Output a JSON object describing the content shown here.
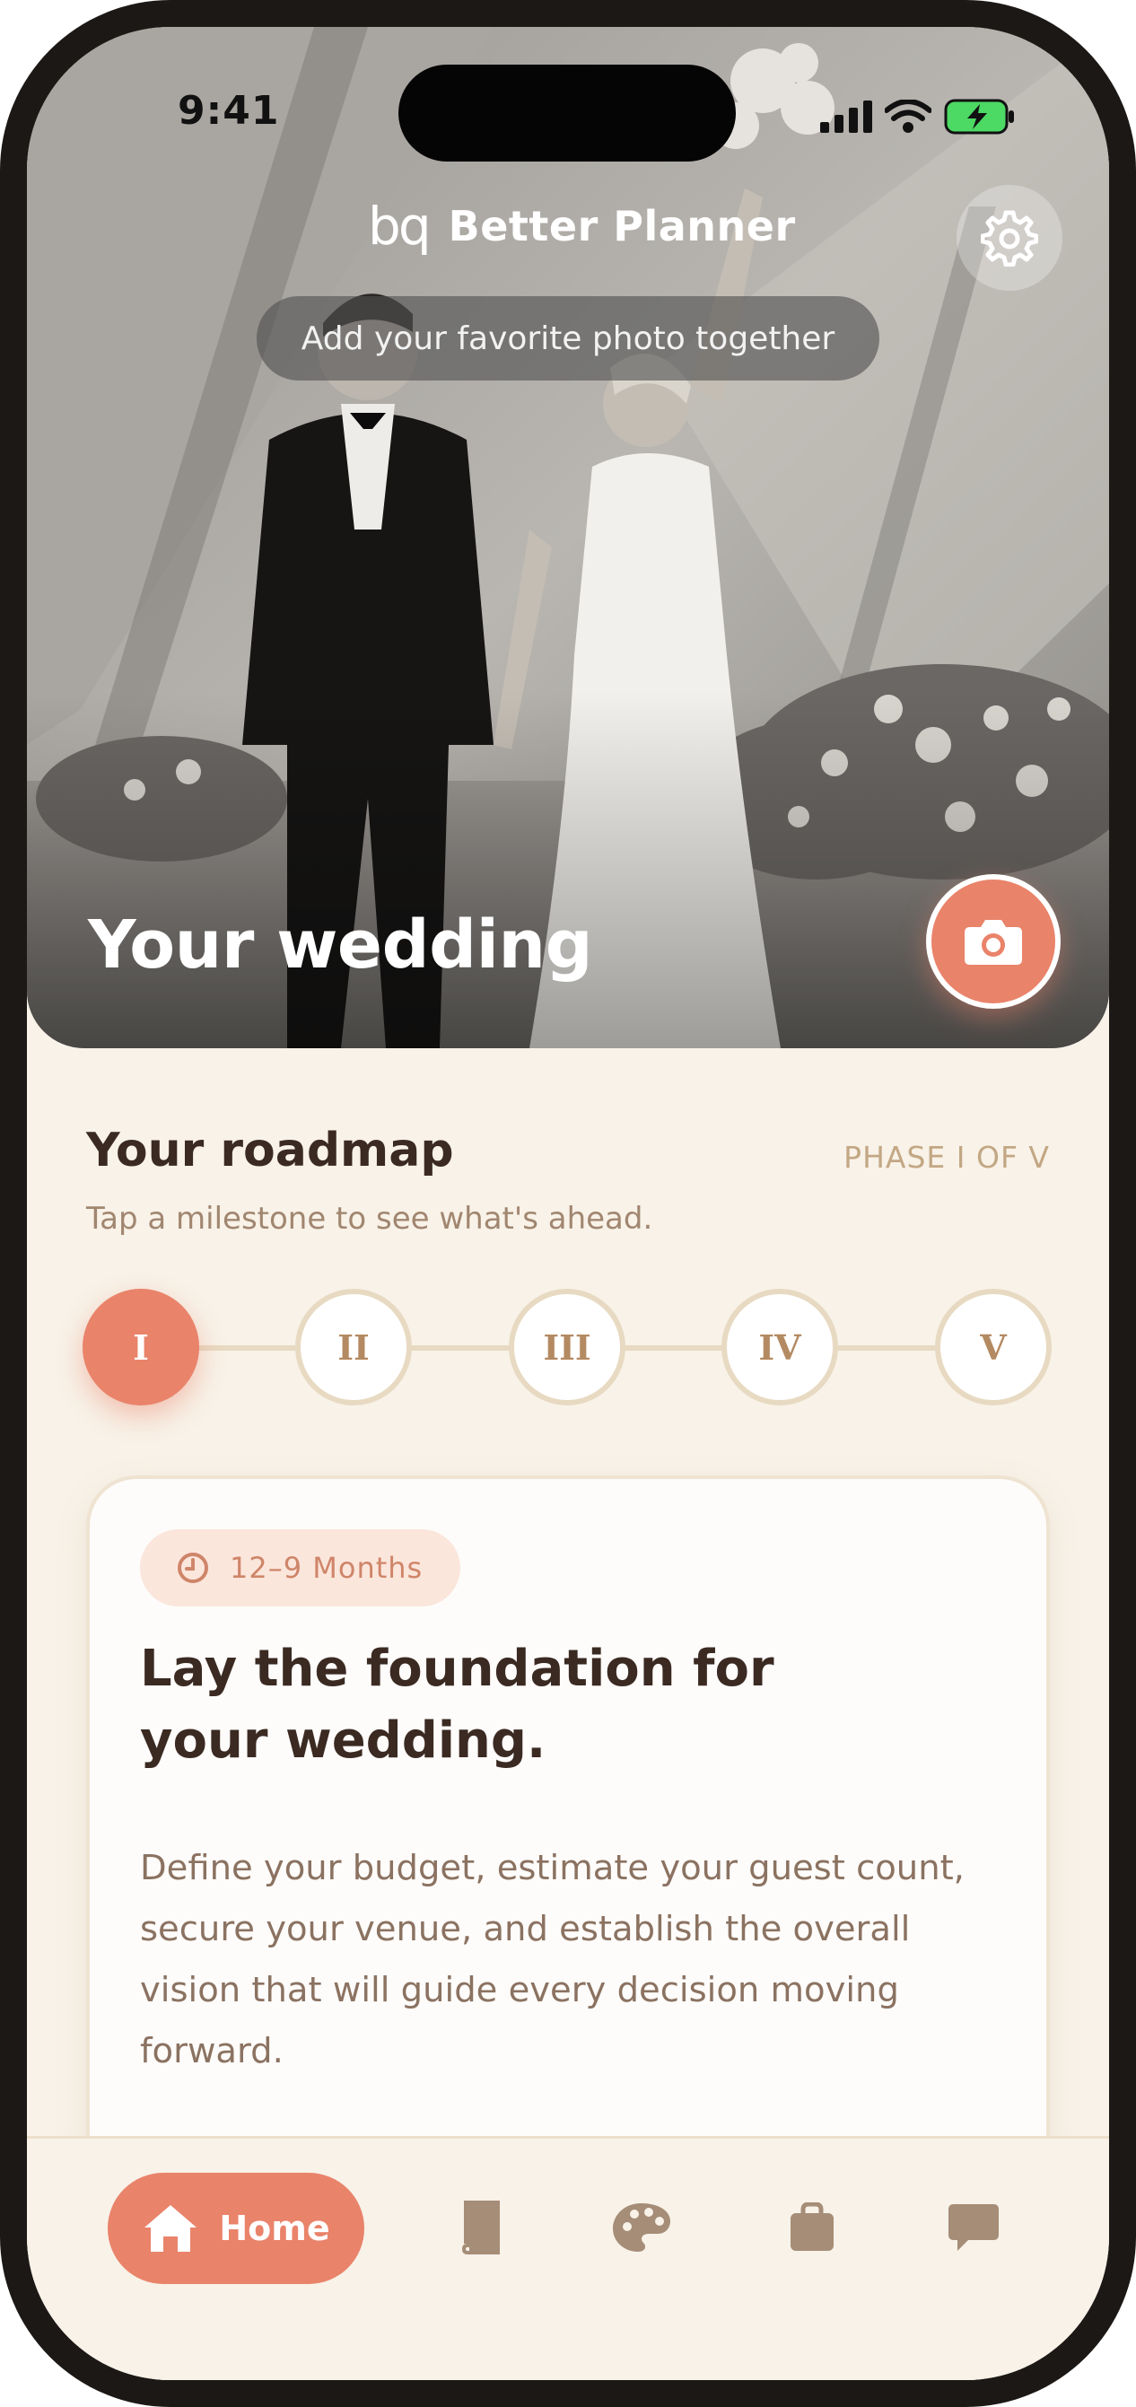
{
  "status_bar": {
    "time": "9:41"
  },
  "header": {
    "brand_logo": "bq",
    "brand_name": "Better Planner"
  },
  "hero": {
    "photo_prompt": "Add your favorite photo together",
    "title": "Your wedding"
  },
  "roadmap": {
    "title": "Your roadmap",
    "phase_label": "PHASE I OF V",
    "subtitle": "Tap a milestone to see what's ahead.",
    "milestones": [
      "I",
      "II",
      "III",
      "IV",
      "V"
    ],
    "active_index": 0
  },
  "phase_card": {
    "timeframe": "12–9 Months",
    "heading": "Lay the foundation for your wedding.",
    "body": "Define your budget, estimate your guest count, secure your venue, and establish the overall vision that will guide every decision moving forward."
  },
  "tabbar": {
    "items": [
      {
        "icon": "home-icon",
        "label": "Home",
        "active": true
      },
      {
        "icon": "book-icon",
        "active": false
      },
      {
        "icon": "palette-icon",
        "active": false
      },
      {
        "icon": "bag-icon",
        "active": false
      },
      {
        "icon": "chat-icon",
        "active": false
      }
    ]
  },
  "colors": {
    "accent": "#e9836a",
    "background": "#f8f2e8",
    "heading": "#3b2a22",
    "muted": "#a18670",
    "tab_icon": "#a58d77"
  }
}
